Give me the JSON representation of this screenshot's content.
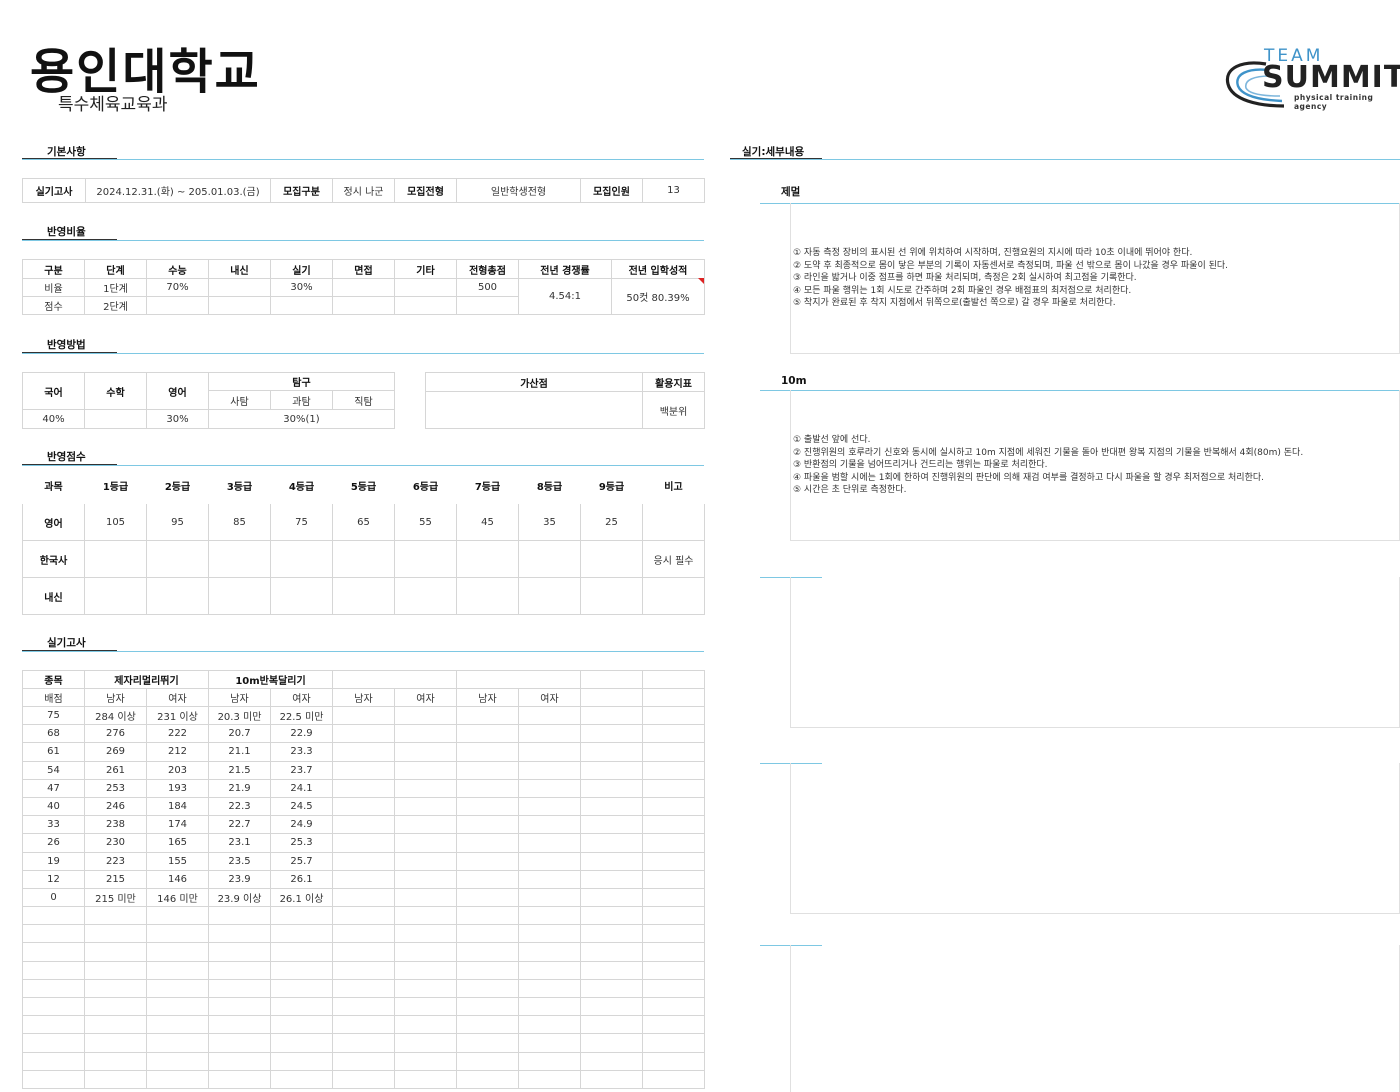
{
  "header": {
    "university": "용인대학교",
    "department": "특수체육교육과"
  },
  "logo": {
    "team": "TEAM",
    "summit": "SUMMIT",
    "tagline": "physical training agency",
    "accent_color": "#3f93c9",
    "icon": "swoosh-icon"
  },
  "basic": {
    "title": "기본사항",
    "exam_label": "실기고사",
    "exam_date": "2024.12.31.(화) ~ 205.01.03.(금)",
    "recruit_type_label": "모집구분",
    "recruit_type": "정시 나군",
    "recruit_track_label": "모집전형",
    "recruit_track": "일반학생전형",
    "recruit_count_label": "모집인원",
    "recruit_count": "13"
  },
  "ratio": {
    "title": "반영비율",
    "headers": [
      "구분",
      "단계",
      "수능",
      "내신",
      "실기",
      "면접",
      "기타",
      "전형총점",
      "전년 경쟁률",
      "전년 입학성적"
    ],
    "row1": [
      "비율",
      "1단계",
      "70%",
      "",
      "30%",
      "",
      "",
      "500"
    ],
    "row2": [
      "점수",
      "2단계",
      "",
      "",
      "",
      "",
      "",
      ""
    ],
    "competition": "4.54:1",
    "admission": "50컷 80.39%"
  },
  "method": {
    "title": "반영방법",
    "korean": "국어",
    "math": "수학",
    "english": "영어",
    "inquiry": "탐구",
    "social": "사탐",
    "science": "과탐",
    "vocational": "직탐",
    "korean_val": "40%",
    "math_val": "",
    "english_val": "30%",
    "inquiry_val": "30%(1)",
    "bonus_label": "가산점",
    "bonus_val": "",
    "index_label": "활용지표",
    "index_val": "백분위"
  },
  "grade": {
    "title": "반영점수",
    "headers": [
      "과목",
      "1등급",
      "2등급",
      "3등급",
      "4등급",
      "5등급",
      "6등급",
      "7등급",
      "8등급",
      "9등급",
      "비고"
    ],
    "rows": [
      [
        "영어",
        "105",
        "95",
        "85",
        "75",
        "65",
        "55",
        "45",
        "35",
        "25",
        ""
      ],
      [
        "한국사",
        "",
        "",
        "",
        "",
        "",
        "",
        "",
        "",
        "",
        "응시 필수"
      ],
      [
        "내신",
        "",
        "",
        "",
        "",
        "",
        "",
        "",
        "",
        "",
        ""
      ]
    ]
  },
  "practical": {
    "title": "실기고사",
    "item_label": "종목",
    "event1": "제자리멀리뛰기",
    "event2": "10m반복달리기",
    "score_label": "배점",
    "male": "남자",
    "female": "여자",
    "rows": [
      [
        "75",
        "284 이상",
        "231 이상",
        "20.3 미만",
        "22.5 미만"
      ],
      [
        "68",
        "276",
        "222",
        "20.7",
        "22.9"
      ],
      [
        "61",
        "269",
        "212",
        "21.1",
        "23.3"
      ],
      [
        "54",
        "261",
        "203",
        "21.5",
        "23.7"
      ],
      [
        "47",
        "253",
        "193",
        "21.9",
        "24.1"
      ],
      [
        "40",
        "246",
        "184",
        "22.3",
        "24.5"
      ],
      [
        "33",
        "238",
        "174",
        "22.7",
        "24.9"
      ],
      [
        "26",
        "230",
        "165",
        "23.1",
        "25.3"
      ],
      [
        "19",
        "223",
        "155",
        "23.5",
        "25.7"
      ],
      [
        "12",
        "215",
        "146",
        "23.9",
        "26.1"
      ],
      [
        "0",
        "215 미만",
        "146 미만",
        "23.9 이상",
        "26.1 이상"
      ]
    ]
  },
  "detail": {
    "title": "실기:세부내용",
    "jump_title": "제멀",
    "jump_lines": [
      "① 자동 측정 장비의 표시된 선 위에 위치하여 시작하며, 진행요원의 지시에 따라 10초 이내에 뛰어야 한다.",
      "② 도약 후 최종적으로 몸이 닿은 부분의 기록이 자동센서로 측정되며, 파울 선 밖으로 몸이 나갔을 경우 파울이 된다.",
      "③ 라인을 밟거나 이중 점프를 하면 파울 처리되며, 측정은 2회 실시하여 최고점을 기록한다.",
      "④ 모든 파울 행위는 1회 시도로 간주하며 2회 파울인 경우 배점표의 최저점으로 처리한다.",
      "⑤ 착지가 완료된 후 착지 지점에서 뒤쪽으로(출발선 쪽으로) 갈 경우 파울로 처리한다."
    ],
    "run_title": "10m",
    "run_lines": [
      "① 출발선 앞에 선다.",
      "② 진행위원의 호루라기 신호와 동시에 실시하고 10m 지점에 세워진 기물을 돌아 반대편 왕복 지점의 기물을 반복해서 4회(80m) 돈다.",
      "③ 반환점의 기물을 넘어뜨리거나 건드리는 행위는 파울로 처리한다.",
      "④ 파울을 범할 시에는 1회에 한하여 진행위원의 판단에 의해 재검 여부를 결정하고 다시 파울을 할 경우 최저점으로 처리한다.",
      "⑤ 시간은 초 단위로 측정한다."
    ]
  }
}
